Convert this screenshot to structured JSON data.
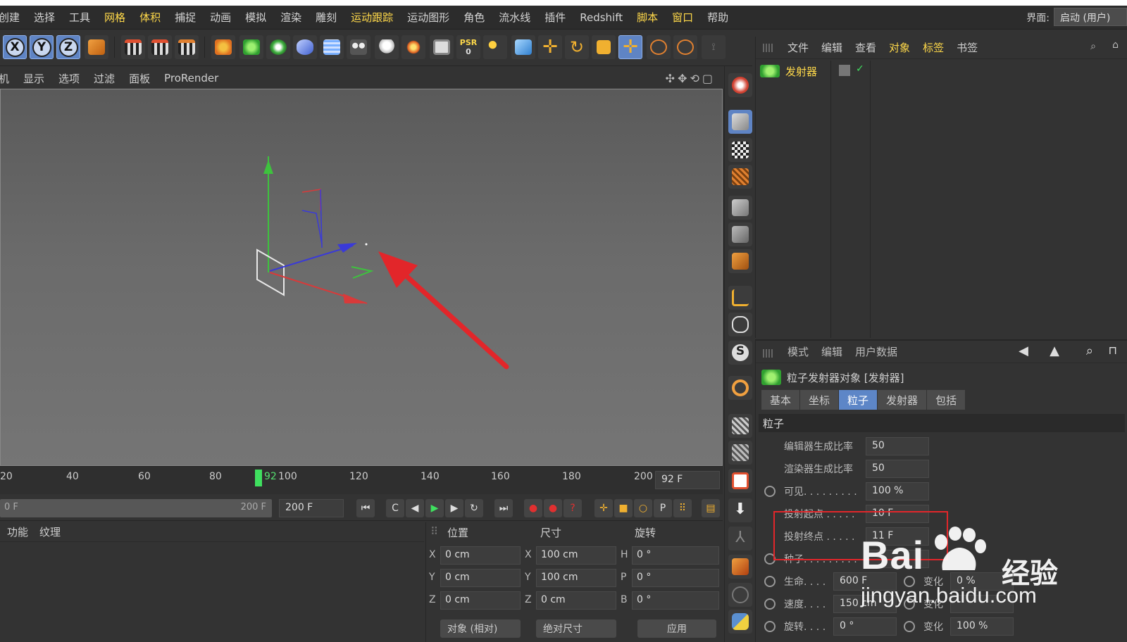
{
  "menubar": {
    "items": [
      "创建",
      "选择",
      "工具",
      "网格",
      "体积",
      "捕捉",
      "动画",
      "模拟",
      "渲染",
      "雕刻",
      "运动跟踪",
      "运动图形",
      "角色",
      "流水线",
      "插件",
      "Redshift",
      "脚本",
      "窗口",
      "帮助"
    ],
    "layout_label": "界面:",
    "layout_value": "启动 (用户)"
  },
  "toolbar": {
    "axis": [
      "X",
      "Y",
      "Z"
    ],
    "icons": [
      "coordinate-system-icon",
      "render-view-icon",
      "render-picture-viewer-icon",
      "render-settings-icon",
      "pen-icon",
      "cube-generator-icon",
      "flower-array-icon",
      "deformer-icon",
      "floor-icon",
      "camera-icon",
      "light-icon",
      "effector-icon",
      "material-icon",
      "psr-icon",
      "xyz-lock-icon",
      "cube-icon",
      "move-icon",
      "rotate-icon",
      "scale-icon",
      "live-select-icon",
      "select-arrow-icon",
      "selection-icon",
      "axis-lock-icon"
    ],
    "psr_label": "PSR",
    "psr_value": "0"
  },
  "viewport_menu": {
    "items": [
      "机",
      "显示",
      "选项",
      "过滤",
      "面板",
      "ProRender"
    ]
  },
  "timeline": {
    "ticks": [
      "20",
      "40",
      "60",
      "80",
      "100",
      "120",
      "140",
      "160",
      "180",
      "200"
    ],
    "current_label": "92",
    "current_frame": "92 F",
    "current_value": 92,
    "range_start": "0 F",
    "range_end": "200 F",
    "end_field": "200 F"
  },
  "bottom_left": {
    "menu": [
      "功能",
      "纹理"
    ]
  },
  "coords": {
    "headers": {
      "position": "位置",
      "size": "尺寸",
      "rotation": "旋转"
    },
    "rows": [
      {
        "axis": "X",
        "pos": "0 cm",
        "saxis": "X",
        "size": "100 cm",
        "raxis": "H",
        "rot": "0 °"
      },
      {
        "axis": "Y",
        "pos": "0 cm",
        "saxis": "Y",
        "size": "100 cm",
        "raxis": "P",
        "rot": "0 °"
      },
      {
        "axis": "Z",
        "pos": "0 cm",
        "saxis": "Z",
        "size": "0 cm",
        "raxis": "B",
        "rot": "0 °"
      }
    ],
    "mode": "对象 (相对)",
    "size_mode": "绝对尺寸",
    "apply": "应用"
  },
  "object_manager": {
    "menu": [
      "文件",
      "编辑",
      "查看",
      "对象",
      "标签",
      "书签"
    ],
    "object_name": "发射器"
  },
  "attributes": {
    "menu": [
      "模式",
      "编辑",
      "用户数据"
    ],
    "title": "粒子发射器对象 [发射器]",
    "tabs": [
      "基本",
      "坐标",
      "粒子",
      "发射器",
      "包括"
    ],
    "active_tab": "粒子",
    "section": "粒子",
    "params": [
      {
        "label": "编辑器生成比率",
        "value": "50"
      },
      {
        "label": "渲染器生成比率",
        "value": "50"
      },
      {
        "label": "可见. . . . . . . . .",
        "value": "100 %"
      },
      {
        "label": "投射起点 . . . . .",
        "value": "10 F"
      },
      {
        "label": "投射终点 . . . . .",
        "value": "11 F"
      },
      {
        "label": "种子. . . . . . . . .",
        "value": ""
      },
      {
        "label": "生命. . . .",
        "value": "600 F",
        "var_label": "变化",
        "var_value": "0 %"
      },
      {
        "label": "速度. . . .",
        "value": "150 cm",
        "var_label": "变化",
        "var_value": ""
      },
      {
        "label": "旋转. . . .",
        "value": "0 °",
        "var_label": "变化",
        "var_value": "100 %"
      }
    ]
  },
  "watermark": {
    "brand": "Bai",
    "brand2": "经验",
    "url": "jingyan.baidu.com"
  },
  "colors": {
    "highlight_yellow": "#ffd94a",
    "active_tab_blue": "#5d86c7",
    "annotation_red": "#e2262a",
    "timeline_green": "#3fe05f"
  }
}
